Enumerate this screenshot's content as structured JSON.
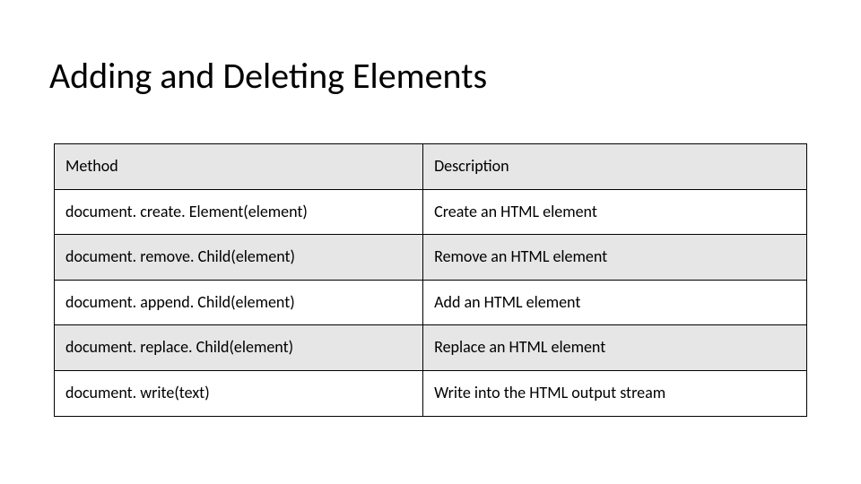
{
  "title": "Adding and Deleting Elements",
  "table": {
    "headers": {
      "method": "Method",
      "description": "Description"
    },
    "rows": [
      {
        "method": "document. create. Element(element)",
        "description": "Create an HTML element"
      },
      {
        "method": "document. remove. Child(element)",
        "description": "Remove an HTML element"
      },
      {
        "method": "document. append. Child(element)",
        "description": "Add an HTML element"
      },
      {
        "method": "document. replace. Child(element)",
        "description": "Replace an HTML element"
      },
      {
        "method": "document. write(text)",
        "description": "Write into the HTML output stream"
      }
    ]
  }
}
